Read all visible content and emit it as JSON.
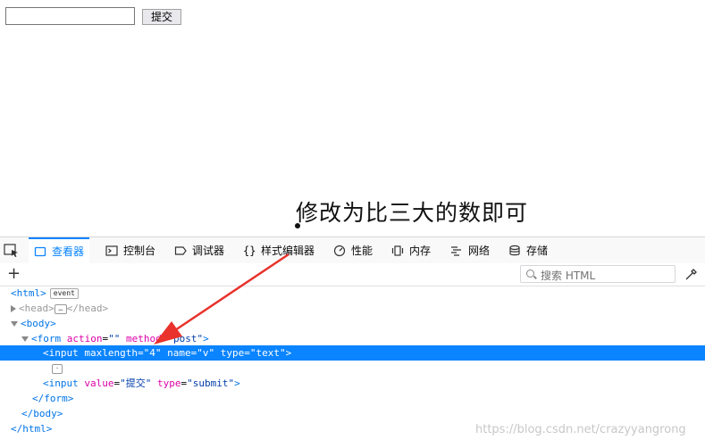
{
  "page": {
    "input_value": "",
    "submit_label": "提交",
    "annotation": "修改为比三大的数即可"
  },
  "devtools": {
    "tabs": [
      {
        "label": "查看器",
        "icon": "inspector-icon"
      },
      {
        "label": "控制台",
        "icon": "console-icon"
      },
      {
        "label": "调试器",
        "icon": "debugger-icon"
      },
      {
        "label": "样式编辑器",
        "icon": "style-editor-icon"
      },
      {
        "label": "性能",
        "icon": "performance-icon"
      },
      {
        "label": "内存",
        "icon": "memory-icon"
      },
      {
        "label": "网络",
        "icon": "network-icon"
      },
      {
        "label": "存储",
        "icon": "storage-icon"
      }
    ],
    "search_placeholder": "搜索 HTML",
    "accent_color": "#0a84ff"
  },
  "dom": {
    "html_open": "<html>",
    "event_badge": "event",
    "head": "<head>",
    "head_close": "</head>",
    "body_open": "<body>",
    "form_tag": "form",
    "form_action_attr": "action",
    "form_action_val": "\"\"",
    "form_method_attr": "method",
    "form_method_val": "\"post\"",
    "input1_tag": "input",
    "input1_maxlength_attr": "maxlength",
    "input1_maxlength_val": "\"4\"",
    "input1_name_attr": "name",
    "input1_name_val": "\"v\"",
    "input1_type_attr": "type",
    "input1_type_val": "\"text\"",
    "input2_tag": "input",
    "input2_value_attr": "value",
    "input2_value_val": "\"提交\"",
    "input2_type_attr": "type",
    "input2_type_val": "\"submit\"",
    "form_close": "</form>",
    "body_close": "</body>",
    "html_close": "</html>"
  },
  "watermark": "https://blog.csdn.net/crazyyangrong"
}
